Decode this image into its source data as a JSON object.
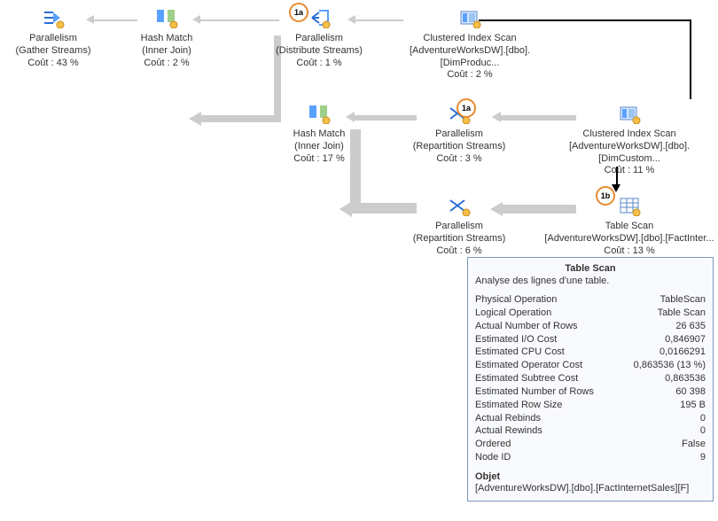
{
  "nodes": {
    "gather": {
      "title": "Parallelism",
      "sub": "(Gather Streams)",
      "cost": "Coût : 43 %"
    },
    "hash1": {
      "title": "Hash Match",
      "sub": "(Inner Join)",
      "cost": "Coût : 2 %"
    },
    "dist": {
      "title": "Parallelism",
      "sub": "(Distribute Streams)",
      "cost": "Coût : 1 %"
    },
    "cix_prod": {
      "title": "Clustered Index Scan",
      "sub": "[AdventureWorksDW].[dbo].[DimProduc...",
      "cost": "Coût : 2 %"
    },
    "hash2": {
      "title": "Hash Match",
      "sub": "(Inner Join)",
      "cost": "Coût : 17 %"
    },
    "rep1": {
      "title": "Parallelism",
      "sub": "(Repartition Streams)",
      "cost": "Coût : 3 %"
    },
    "cix_cust": {
      "title": "Clustered Index Scan",
      "sub": "[AdventureWorksDW].[dbo].[DimCustom...",
      "cost": "Coût : 11 %"
    },
    "rep2": {
      "title": "Parallelism",
      "sub": "(Repartition Streams)",
      "cost": "Coût : 6 %"
    },
    "tscan": {
      "title": "Table Scan",
      "sub": "[AdventureWorksDW].[dbo].[FactInter...",
      "cost": "Coût : 13 %"
    }
  },
  "badges": {
    "a1": "1a",
    "a2": "1a",
    "b": "1b"
  },
  "tooltip": {
    "title": "Table Scan",
    "desc": "Analyse des lignes d'une table.",
    "rows": [
      {
        "k": "Physical Operation",
        "v": "TableScan"
      },
      {
        "k": "Logical Operation",
        "v": "Table Scan"
      },
      {
        "k": "Actual Number of Rows",
        "v": "26 635"
      },
      {
        "k": "Estimated I/O Cost",
        "v": "0,846907"
      },
      {
        "k": "Estimated CPU Cost",
        "v": "0,0166291"
      },
      {
        "k": "Estimated Operator Cost",
        "v": "0,863536 (13 %)"
      },
      {
        "k": "Estimated Subtree Cost",
        "v": "0,863536"
      },
      {
        "k": "Estimated Number of Rows",
        "v": "60 398"
      },
      {
        "k": "Estimated Row Size",
        "v": "195 B"
      },
      {
        "k": "Actual Rebinds",
        "v": "0"
      },
      {
        "k": "Actual Rewinds",
        "v": "0"
      },
      {
        "k": "Ordered",
        "v": "False"
      },
      {
        "k": "Node ID",
        "v": "9"
      }
    ],
    "obj_label": "Objet",
    "obj_value": "[AdventureWorksDW].[dbo].[FactInternetSales][F]"
  }
}
